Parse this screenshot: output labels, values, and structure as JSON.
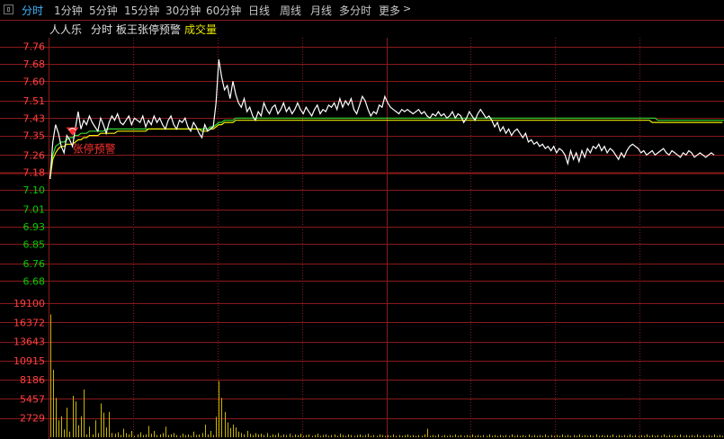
{
  "tabs": [
    {
      "label": "分时",
      "active": true
    },
    {
      "label": "1分钟"
    },
    {
      "label": "5分钟"
    },
    {
      "label": "15分钟"
    },
    {
      "label": "30分钟"
    },
    {
      "label": "60分钟"
    },
    {
      "label": "日线"
    },
    {
      "label": "周线"
    },
    {
      "label": "月线"
    },
    {
      "label": "多分时"
    },
    {
      "label": "更多"
    }
  ],
  "toggle_icon": "panel-toggle-icon",
  "more_icon": "chevron-right-icon",
  "info": {
    "stock_name": "人人乐",
    "view": "分时",
    "indicator": "板王张停预警",
    "volume_label": "成交量"
  },
  "colors": {
    "background": "#000000",
    "grid": "#8a1a1a",
    "price_line": "#ffffff",
    "avg_line": "#f0f000",
    "green_line": "#33dd33",
    "axis_up": "#ff4040",
    "axis_down": "#00d000",
    "volume": "#c8b400",
    "alert": "#ff3030",
    "active_tab": "#3fb6ff"
  },
  "chart_data": {
    "type": "line",
    "prev_close": 7.18,
    "price_ticks": [
      "7.76",
      "7.68",
      "7.60",
      "7.51",
      "7.43",
      "7.35",
      "7.26",
      "7.18",
      "7.10",
      "7.01",
      "6.93",
      "6.85",
      "6.76",
      "6.68"
    ],
    "volume_ticks": [
      "19100",
      "16372",
      "13643",
      "10915",
      "8186",
      "5457",
      "2729"
    ],
    "ylim_price": [
      6.64,
      7.8
    ],
    "ylim_volume": [
      0,
      19100
    ],
    "minutes": 240,
    "price": [
      7.15,
      7.32,
      7.4,
      7.36,
      7.3,
      7.27,
      7.35,
      7.33,
      7.3,
      7.38,
      7.46,
      7.38,
      7.42,
      7.4,
      7.44,
      7.41,
      7.39,
      7.37,
      7.43,
      7.4,
      7.36,
      7.41,
      7.44,
      7.42,
      7.45,
      7.41,
      7.4,
      7.42,
      7.44,
      7.4,
      7.43,
      7.42,
      7.41,
      7.44,
      7.39,
      7.42,
      7.4,
      7.44,
      7.41,
      7.43,
      7.4,
      7.38,
      7.42,
      7.44,
      7.4,
      7.38,
      7.42,
      7.41,
      7.43,
      7.39,
      7.37,
      7.41,
      7.39,
      7.36,
      7.34,
      7.4,
      7.37,
      7.38,
      7.39,
      7.5,
      7.7,
      7.62,
      7.56,
      7.58,
      7.52,
      7.6,
      7.54,
      7.5,
      7.48,
      7.52,
      7.46,
      7.48,
      7.44,
      7.42,
      7.46,
      7.44,
      7.5,
      7.47,
      7.45,
      7.48,
      7.49,
      7.45,
      7.47,
      7.5,
      7.46,
      7.48,
      7.45,
      7.47,
      7.5,
      7.47,
      7.45,
      7.48,
      7.46,
      7.44,
      7.47,
      7.49,
      7.45,
      7.47,
      7.46,
      7.49,
      7.48,
      7.5,
      7.47,
      7.52,
      7.48,
      7.51,
      7.49,
      7.52,
      7.47,
      7.45,
      7.49,
      7.53,
      7.51,
      7.47,
      7.44,
      7.46,
      7.45,
      7.49,
      7.48,
      7.53,
      7.5,
      7.48,
      7.47,
      7.46,
      7.45,
      7.47,
      7.46,
      7.47,
      7.46,
      7.45,
      7.46,
      7.47,
      7.45,
      7.46,
      7.44,
      7.43,
      7.45,
      7.44,
      7.46,
      7.44,
      7.45,
      7.43,
      7.44,
      7.46,
      7.43,
      7.45,
      7.44,
      7.41,
      7.43,
      7.46,
      7.44,
      7.42,
      7.45,
      7.47,
      7.45,
      7.43,
      7.44,
      7.42,
      7.39,
      7.41,
      7.37,
      7.39,
      7.36,
      7.38,
      7.35,
      7.37,
      7.38,
      7.36,
      7.34,
      7.36,
      7.32,
      7.33,
      7.31,
      7.32,
      7.3,
      7.31,
      7.29,
      7.3,
      7.28,
      7.3,
      7.27,
      7.29,
      7.28,
      7.26,
      7.22,
      7.28,
      7.24,
      7.27,
      7.23,
      7.28,
      7.25,
      7.29,
      7.27,
      7.3,
      7.29,
      7.31,
      7.28,
      7.3,
      7.27,
      7.29,
      7.28,
      7.26,
      7.24,
      7.27,
      7.25,
      7.28,
      7.3,
      7.31,
      7.3,
      7.29,
      7.27,
      7.28,
      7.26,
      7.27,
      7.28,
      7.26,
      7.27,
      7.28,
      7.29,
      7.27,
      7.26,
      7.28,
      7.27,
      7.26,
      7.25,
      7.27,
      7.26,
      7.28,
      7.27,
      7.25,
      7.26,
      7.27,
      7.26,
      7.25,
      7.26,
      7.27,
      7.26
    ],
    "avg": [
      7.15,
      7.24,
      7.27,
      7.29,
      7.3,
      7.3,
      7.31,
      7.31,
      7.31,
      7.32,
      7.33,
      7.33,
      7.34,
      7.34,
      7.35,
      7.35,
      7.35,
      7.35,
      7.36,
      7.36,
      7.36,
      7.36,
      7.36,
      7.36,
      7.37,
      7.37,
      7.37,
      7.37,
      7.37,
      7.37,
      7.37,
      7.37,
      7.37,
      7.37,
      7.37,
      7.38,
      7.38,
      7.38,
      7.38,
      7.38,
      7.38,
      7.38,
      7.38,
      7.38,
      7.38,
      7.38,
      7.38,
      7.38,
      7.38,
      7.38,
      7.38,
      7.38,
      7.38,
      7.38,
      7.37,
      7.37,
      7.37,
      7.38,
      7.38,
      7.39,
      7.4,
      7.4,
      7.41,
      7.41,
      7.41,
      7.41,
      7.42,
      7.42,
      7.42,
      7.42,
      7.42,
      7.42,
      7.42,
      7.42,
      7.42,
      7.42,
      7.42,
      7.42,
      7.42,
      7.42,
      7.42,
      7.42,
      7.42,
      7.42,
      7.42,
      7.42,
      7.42,
      7.42,
      7.42,
      7.42,
      7.42,
      7.42,
      7.42,
      7.42,
      7.42,
      7.42,
      7.42,
      7.42,
      7.42,
      7.42,
      7.42,
      7.42,
      7.42,
      7.42,
      7.42,
      7.42,
      7.42,
      7.42,
      7.42,
      7.42,
      7.42,
      7.42,
      7.42,
      7.42,
      7.42,
      7.42,
      7.42,
      7.42,
      7.42,
      7.42,
      7.42,
      7.42,
      7.42,
      7.42,
      7.42,
      7.42,
      7.42,
      7.42,
      7.42,
      7.42,
      7.42,
      7.42,
      7.42,
      7.42,
      7.42,
      7.42,
      7.42,
      7.42,
      7.42,
      7.42,
      7.42,
      7.42,
      7.42,
      7.42,
      7.42,
      7.42,
      7.42,
      7.42,
      7.42,
      7.42,
      7.42,
      7.42,
      7.42,
      7.42,
      7.42,
      7.42,
      7.42,
      7.42,
      7.42,
      7.42,
      7.42,
      7.42,
      7.42,
      7.42,
      7.42,
      7.42,
      7.42,
      7.42,
      7.42,
      7.42,
      7.42,
      7.42,
      7.42,
      7.42,
      7.42,
      7.42,
      7.42,
      7.42,
      7.42,
      7.42,
      7.42,
      7.42,
      7.42,
      7.42,
      7.42,
      7.42,
      7.42,
      7.42,
      7.42,
      7.42,
      7.42,
      7.42,
      7.42,
      7.42,
      7.42,
      7.42,
      7.42,
      7.42,
      7.42,
      7.42,
      7.42,
      7.42,
      7.42,
      7.42,
      7.42,
      7.42,
      7.42,
      7.42,
      7.42,
      7.42,
      7.42,
      7.42,
      7.42,
      7.42,
      7.41,
      7.41,
      7.41,
      7.41,
      7.41,
      7.41,
      7.41,
      7.41,
      7.41,
      7.41,
      7.41,
      7.41,
      7.41,
      7.41,
      7.41,
      7.41,
      7.41,
      7.41,
      7.41,
      7.41,
      7.41,
      7.41,
      7.41,
      7.41,
      7.41,
      7.41
    ],
    "green": [
      7.15,
      7.26,
      7.3,
      7.31,
      7.32,
      7.32,
      7.33,
      7.34,
      7.34,
      7.35,
      7.35,
      7.36,
      7.36,
      7.36,
      7.37,
      7.37,
      7.37,
      7.37,
      7.37,
      7.37,
      7.38,
      7.38,
      7.38,
      7.38,
      7.38,
      7.38,
      7.38,
      7.38,
      7.38,
      7.38,
      7.38,
      7.38,
      7.38,
      7.38,
      7.38,
      7.38,
      7.38,
      7.38,
      7.38,
      7.38,
      7.38,
      7.38,
      7.38,
      7.38,
      7.38,
      7.38,
      7.38,
      7.38,
      7.38,
      7.38,
      7.38,
      7.38,
      7.38,
      7.38,
      7.38,
      7.38,
      7.38,
      7.39,
      7.39,
      7.4,
      7.41,
      7.41,
      7.42,
      7.42,
      7.42,
      7.42,
      7.43,
      7.43,
      7.43,
      7.43,
      7.43,
      7.43,
      7.43,
      7.43,
      7.43,
      7.43,
      7.43,
      7.43,
      7.43,
      7.43,
      7.43,
      7.43,
      7.43,
      7.43,
      7.43,
      7.43,
      7.43,
      7.43,
      7.43,
      7.43,
      7.43,
      7.43,
      7.43,
      7.43,
      7.43,
      7.43,
      7.43,
      7.43,
      7.43,
      7.43,
      7.43,
      7.43,
      7.43,
      7.43,
      7.43,
      7.43,
      7.43,
      7.43,
      7.43,
      7.43,
      7.43,
      7.43,
      7.43,
      7.43,
      7.43,
      7.43,
      7.43,
      7.43,
      7.43,
      7.43,
      7.43,
      7.43,
      7.43,
      7.43,
      7.43,
      7.43,
      7.43,
      7.43,
      7.43,
      7.43,
      7.43,
      7.43,
      7.43,
      7.43,
      7.43,
      7.43,
      7.43,
      7.43,
      7.43,
      7.43,
      7.43,
      7.43,
      7.43,
      7.43,
      7.43,
      7.43,
      7.43,
      7.43,
      7.43,
      7.43,
      7.43,
      7.43,
      7.43,
      7.43,
      7.43,
      7.43,
      7.43,
      7.43,
      7.43,
      7.43,
      7.43,
      7.43,
      7.43,
      7.43,
      7.43,
      7.43,
      7.43,
      7.43,
      7.43,
      7.43,
      7.43,
      7.43,
      7.43,
      7.43,
      7.43,
      7.43,
      7.43,
      7.43,
      7.43,
      7.43,
      7.43,
      7.43,
      7.43,
      7.43,
      7.43,
      7.43,
      7.43,
      7.43,
      7.43,
      7.43,
      7.43,
      7.43,
      7.43,
      7.43,
      7.43,
      7.43,
      7.43,
      7.43,
      7.43,
      7.43,
      7.43,
      7.43,
      7.43,
      7.43,
      7.43,
      7.43,
      7.43,
      7.43,
      7.43,
      7.43,
      7.43,
      7.43,
      7.43,
      7.43,
      7.43,
      7.43,
      7.42,
      7.42,
      7.42,
      7.42,
      7.42,
      7.42,
      7.42,
      7.42,
      7.42,
      7.42,
      7.42,
      7.42,
      7.42,
      7.42,
      7.42,
      7.42,
      7.42,
      7.42,
      7.42,
      7.42,
      7.42,
      7.42,
      7.42,
      7.42,
      7.42,
      7.42
    ],
    "volume": [
      17500,
      9600,
      5600,
      2400,
      3000,
      1100,
      4200,
      800,
      5900,
      5100,
      1700,
      3000,
      6800,
      400,
      1500,
      400,
      2400,
      600,
      4800,
      3500,
      1400,
      3600,
      600,
      500,
      700,
      300,
      1200,
      600,
      400,
      900,
      200,
      400,
      700,
      300,
      400,
      1600,
      500,
      900,
      300,
      400,
      600,
      1500,
      300,
      400,
      600,
      300,
      200,
      500,
      300,
      400,
      200,
      800,
      300,
      400,
      600,
      1800,
      400,
      900,
      300,
      2900,
      8000,
      5600,
      3600,
      2100,
      1300,
      1800,
      1400,
      800,
      600,
      400,
      900,
      500,
      300,
      600,
      400,
      500,
      300,
      600,
      200,
      400,
      300,
      600,
      200,
      400,
      300,
      500,
      200,
      400,
      300,
      500,
      200,
      300,
      400,
      200,
      300,
      500,
      200,
      300,
      400,
      200,
      300,
      400,
      200,
      500,
      300,
      200,
      400,
      300,
      200,
      300,
      400,
      200,
      300,
      500,
      200,
      300,
      200,
      400,
      300,
      200,
      300,
      200,
      400,
      200,
      300,
      200,
      300,
      400,
      200,
      300,
      200,
      300,
      200,
      400,
      1200,
      200,
      300,
      200,
      400,
      200,
      300,
      200,
      300,
      200,
      400,
      200,
      300,
      200,
      300,
      200,
      400,
      200,
      300,
      200,
      300,
      200,
      400,
      200,
      300,
      200,
      300,
      200,
      300,
      200,
      400,
      200,
      300,
      200,
      300,
      200,
      400,
      200,
      300,
      200,
      300,
      200,
      400,
      200,
      300,
      200,
      300,
      200,
      400,
      200,
      300,
      200,
      300,
      200,
      400,
      200,
      300,
      200,
      300,
      200,
      400,
      200,
      300,
      200,
      300,
      200,
      400,
      200,
      300,
      200,
      300,
      200,
      400,
      200,
      300,
      200,
      300,
      200,
      400,
      200,
      300,
      200,
      300,
      200,
      400,
      200,
      300,
      200,
      300,
      200,
      400,
      200,
      300,
      200,
      300,
      200,
      400,
      200,
      300,
      200,
      300,
      200,
      400,
      200,
      300,
      200,
      300,
      200,
      300,
      200,
      400,
      200,
      300,
      200
    ],
    "annotation": {
      "label": "张停预警",
      "minute": 8,
      "price": 7.35
    }
  }
}
